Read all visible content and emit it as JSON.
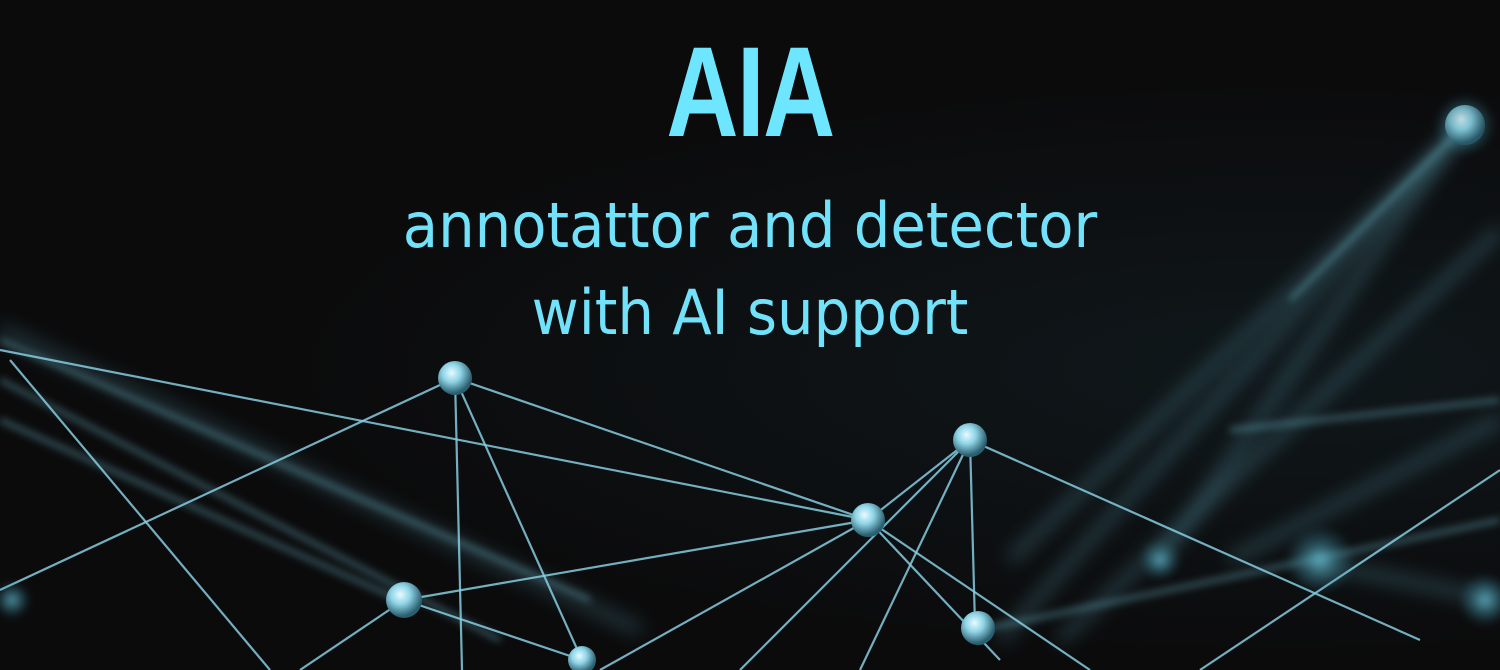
{
  "banner": {
    "title": "AIA",
    "subtitle_line1": "annotattor and detector",
    "subtitle_line2": "with AI support"
  },
  "colors": {
    "background": "#0b0b0c",
    "text_accent": "#6fe6ff",
    "network_line": "#7fc6d9"
  }
}
